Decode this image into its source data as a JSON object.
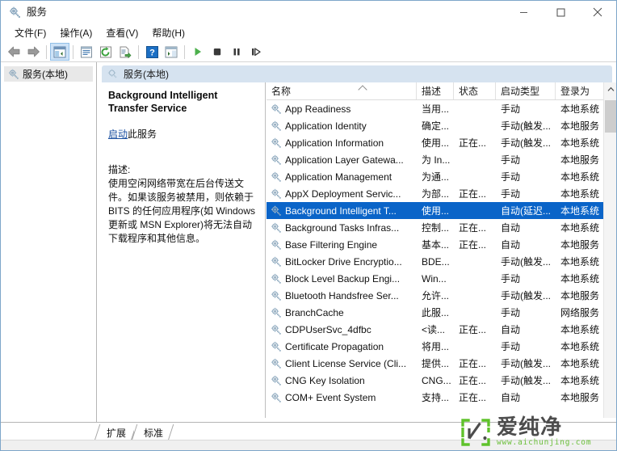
{
  "window": {
    "title": "服务",
    "title_icon": "services-gear-icon",
    "controls": {
      "minimize": "minimize-icon",
      "maximize": "maximize-icon",
      "close": "close-icon"
    }
  },
  "menubar": {
    "items": [
      {
        "label": "文件(F)",
        "name": "menu-file"
      },
      {
        "label": "操作(A)",
        "name": "menu-action"
      },
      {
        "label": "查看(V)",
        "name": "menu-view"
      },
      {
        "label": "帮助(H)",
        "name": "menu-help"
      }
    ]
  },
  "toolbar": {
    "buttons": [
      {
        "name": "back-button",
        "icon": "arrow-left-icon",
        "active": false
      },
      {
        "name": "forward-button",
        "icon": "arrow-right-icon",
        "active": false
      },
      {
        "name": "show-hide-tree-button",
        "icon": "tree-pane-icon",
        "active": true
      },
      {
        "name": "properties-button",
        "icon": "properties-icon",
        "active": false
      },
      {
        "name": "refresh-button",
        "icon": "refresh-icon",
        "active": false
      },
      {
        "name": "export-list-button",
        "icon": "export-list-icon",
        "active": false
      },
      {
        "name": "help-button",
        "icon": "help-question-icon",
        "active": false
      },
      {
        "name": "show-action-pane-button",
        "icon": "action-pane-icon",
        "active": false
      },
      {
        "name": "start-service-button",
        "icon": "play-icon",
        "active": false
      },
      {
        "name": "stop-service-button",
        "icon": "stop-icon",
        "active": false
      },
      {
        "name": "pause-service-button",
        "icon": "pause-icon",
        "active": false
      },
      {
        "name": "restart-service-button",
        "icon": "restart-icon",
        "active": false
      }
    ]
  },
  "tree": {
    "items": [
      {
        "label": "服务(本地)",
        "name": "tree-item-services-local",
        "icon": "services-gear-icon",
        "selected": true
      }
    ]
  },
  "console_header": {
    "icon": "services-gear-icon",
    "title": "服务(本地)"
  },
  "detail": {
    "service_title": "Background Intelligent Transfer Service",
    "action_link": "启动",
    "action_suffix": "此服务",
    "description_label": "描述:",
    "description_body": "使用空闲网络带宽在后台传送文件。如果该服务被禁用，则依赖于 BITS 的任何应用程序(如 Windows 更新或 MSN Explorer)将无法自动下载程序和其他信息。"
  },
  "list": {
    "columns": [
      {
        "label": "名称",
        "name": "column-name",
        "sorted": true
      },
      {
        "label": "描述",
        "name": "column-description",
        "sorted": false
      },
      {
        "label": "状态",
        "name": "column-status",
        "sorted": false
      },
      {
        "label": "启动类型",
        "name": "column-startup-type",
        "sorted": false
      },
      {
        "label": "登录为",
        "name": "column-log-on-as",
        "sorted": false
      }
    ],
    "rows": [
      {
        "name": "App Readiness",
        "desc": "当用...",
        "status": "",
        "startup": "手动",
        "logon": "本地系统",
        "selected": false
      },
      {
        "name": "Application Identity",
        "desc": "确定...",
        "status": "",
        "startup": "手动(触发...",
        "logon": "本地服务",
        "selected": false
      },
      {
        "name": "Application Information",
        "desc": "使用...",
        "status": "正在...",
        "startup": "手动(触发...",
        "logon": "本地系统",
        "selected": false
      },
      {
        "name": "Application Layer Gatewa...",
        "desc": "为 In...",
        "status": "",
        "startup": "手动",
        "logon": "本地服务",
        "selected": false
      },
      {
        "name": "Application Management",
        "desc": "为通...",
        "status": "",
        "startup": "手动",
        "logon": "本地系统",
        "selected": false
      },
      {
        "name": "AppX Deployment Servic...",
        "desc": "为部...",
        "status": "正在...",
        "startup": "手动",
        "logon": "本地系统",
        "selected": false
      },
      {
        "name": "Background Intelligent T...",
        "desc": "使用...",
        "status": "",
        "startup": "自动(延迟...",
        "logon": "本地系统",
        "selected": true
      },
      {
        "name": "Background Tasks Infras...",
        "desc": "控制...",
        "status": "正在...",
        "startup": "自动",
        "logon": "本地系统",
        "selected": false
      },
      {
        "name": "Base Filtering Engine",
        "desc": "基本...",
        "status": "正在...",
        "startup": "自动",
        "logon": "本地服务",
        "selected": false
      },
      {
        "name": "BitLocker Drive Encryptio...",
        "desc": "BDE...",
        "status": "",
        "startup": "手动(触发...",
        "logon": "本地系统",
        "selected": false
      },
      {
        "name": "Block Level Backup Engi...",
        "desc": "Win...",
        "status": "",
        "startup": "手动",
        "logon": "本地系统",
        "selected": false
      },
      {
        "name": "Bluetooth Handsfree Ser...",
        "desc": "允许...",
        "status": "",
        "startup": "手动(触发...",
        "logon": "本地服务",
        "selected": false
      },
      {
        "name": "BranchCache",
        "desc": "此服...",
        "status": "",
        "startup": "手动",
        "logon": "网络服务",
        "selected": false
      },
      {
        "name": "CDPUserSvc_4dfbc",
        "desc": "<读...",
        "status": "正在...",
        "startup": "自动",
        "logon": "本地系统",
        "selected": false
      },
      {
        "name": "Certificate Propagation",
        "desc": "将用...",
        "status": "",
        "startup": "手动",
        "logon": "本地系统",
        "selected": false
      },
      {
        "name": "Client License Service (Cli...",
        "desc": "提供...",
        "status": "正在...",
        "startup": "手动(触发...",
        "logon": "本地系统",
        "selected": false
      },
      {
        "name": "CNG Key Isolation",
        "desc": "CNG...",
        "status": "正在...",
        "startup": "手动(触发...",
        "logon": "本地系统",
        "selected": false
      },
      {
        "name": "COM+ Event System",
        "desc": "支持...",
        "status": "正在...",
        "startup": "自动",
        "logon": "本地服务",
        "selected": false
      }
    ],
    "scrollbar": {
      "up_arrow": "chevron-up-icon",
      "thumb": "scroll-thumb"
    }
  },
  "bottom_tabs": [
    {
      "label": "扩展",
      "name": "tab-extended",
      "selected": false
    },
    {
      "label": "标准",
      "name": "tab-standard",
      "selected": true
    }
  ],
  "watermark": {
    "brand_cn": "爱纯净",
    "url": "www.aichunjing.com",
    "logo_color": "#5fc22b",
    "text_color": "#4c4c4c"
  },
  "colors": {
    "selection_blue": "#0a64c8",
    "header_band": "#d6e3f0",
    "link_blue": "#1a4fa0",
    "window_border": "#7ea6c9"
  }
}
